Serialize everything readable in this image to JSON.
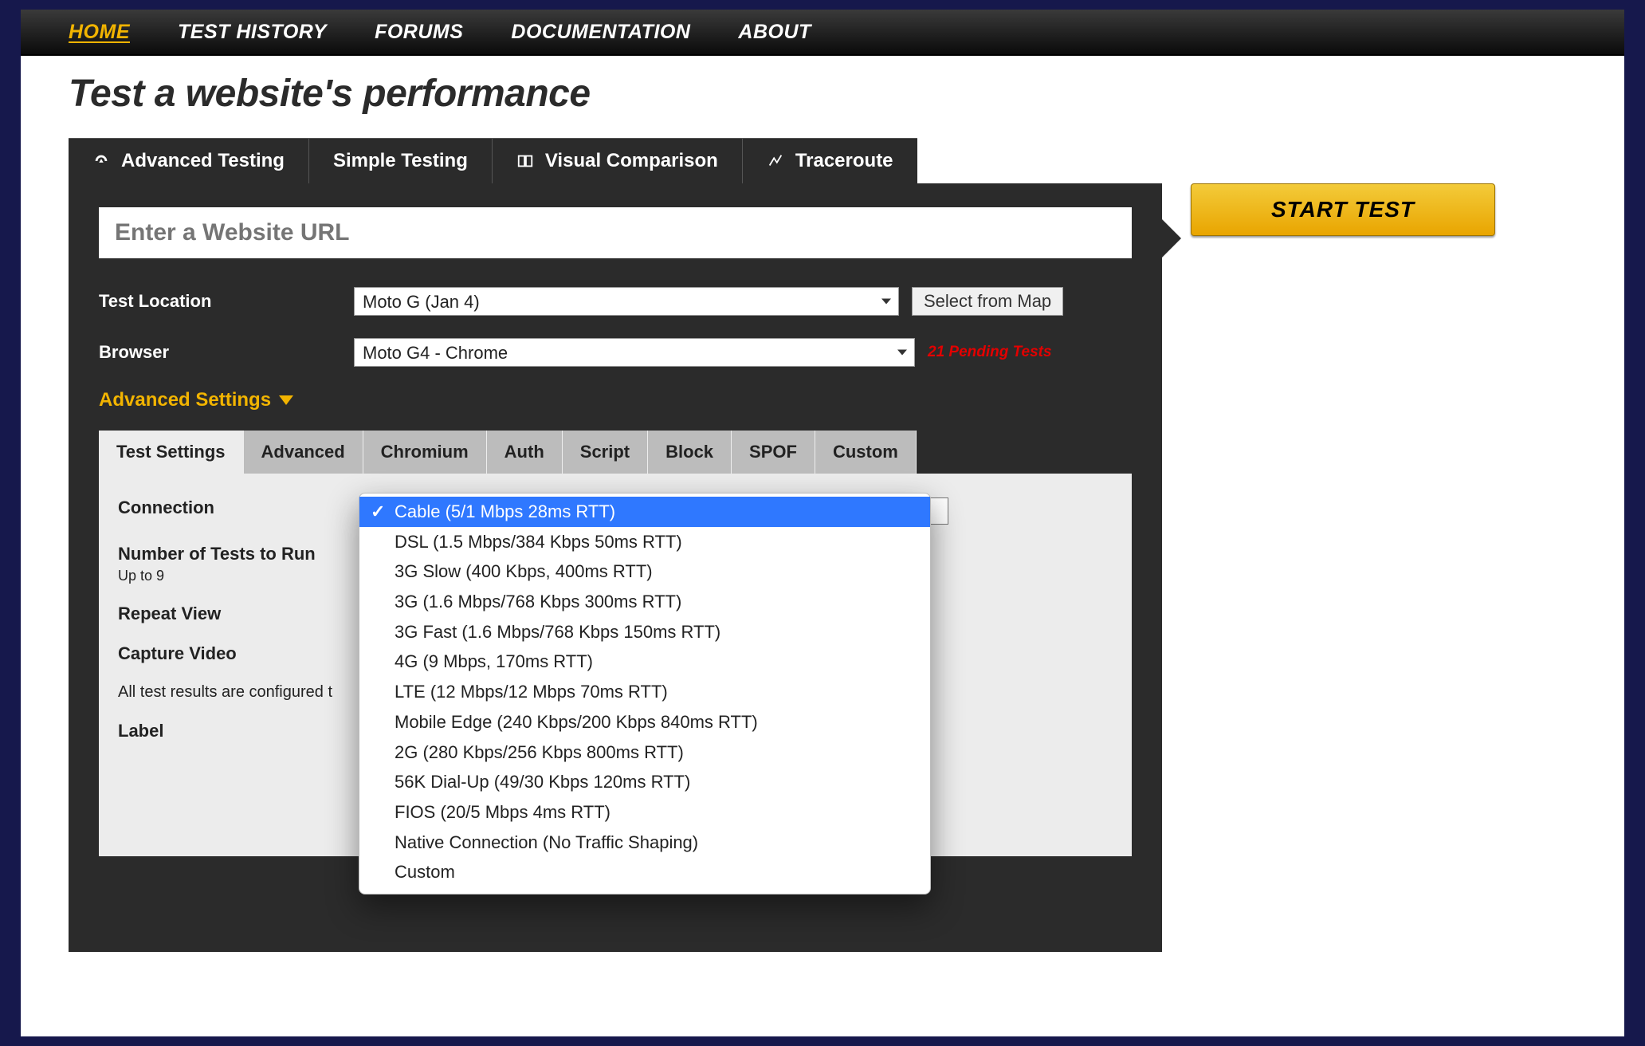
{
  "nav": {
    "items": [
      {
        "label": "HOME",
        "active": true
      },
      {
        "label": "TEST HISTORY"
      },
      {
        "label": "FORUMS"
      },
      {
        "label": "DOCUMENTATION"
      },
      {
        "label": "ABOUT"
      }
    ]
  },
  "page": {
    "title": "Test a website's performance"
  },
  "mode_tabs": [
    {
      "label": "Advanced Testing",
      "icon": "gauge-icon",
      "active": true
    },
    {
      "label": "Simple Testing",
      "icon": null
    },
    {
      "label": "Visual Comparison",
      "icon": "compare-icon"
    },
    {
      "label": "Traceroute",
      "icon": "route-icon"
    }
  ],
  "start_button": "START TEST",
  "form": {
    "url_placeholder": "Enter a Website URL",
    "location_label": "Test Location",
    "location_value": "Moto G (Jan 4)",
    "map_button": "Select from Map",
    "browser_label": "Browser",
    "browser_value": "Moto G4 - Chrome",
    "pending_tests": "21 Pending Tests",
    "advanced_toggle": "Advanced Settings"
  },
  "settings_tabs": [
    "Test Settings",
    "Advanced",
    "Chromium",
    "Auth",
    "Script",
    "Block",
    "SPOF",
    "Custom"
  ],
  "settings_active_tab": 0,
  "test_settings": {
    "connection_label": "Connection",
    "num_tests_label": "Number of Tests to Run",
    "num_tests_hint": "Up to 9",
    "repeat_view_label": "Repeat View",
    "capture_video_label": "Capture Video",
    "results_note_truncated": "All test results are configured t",
    "label_label": "Label"
  },
  "connection_options": [
    "Cable (5/1 Mbps 28ms RTT)",
    "DSL (1.5 Mbps/384 Kbps 50ms RTT)",
    "3G Slow (400 Kbps, 400ms RTT)",
    "3G (1.6 Mbps/768 Kbps 300ms RTT)",
    "3G Fast (1.6 Mbps/768 Kbps 150ms RTT)",
    "4G (9 Mbps, 170ms RTT)",
    "LTE (12 Mbps/12 Mbps 70ms RTT)",
    "Mobile Edge (240 Kbps/200 Kbps 840ms RTT)",
    "2G (280 Kbps/256 Kbps 800ms RTT)",
    "56K Dial-Up (49/30 Kbps 120ms RTT)",
    "FIOS (20/5 Mbps 4ms RTT)",
    "Native Connection (No Traffic Shaping)",
    "Custom"
  ],
  "connection_selected_index": 0
}
